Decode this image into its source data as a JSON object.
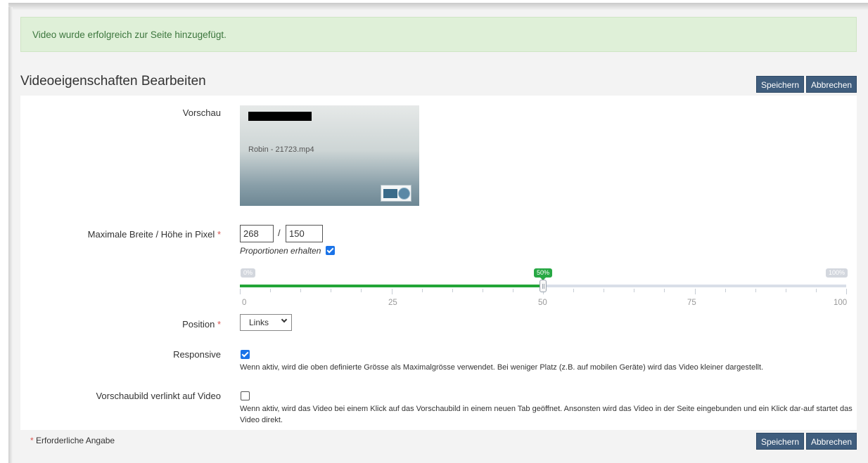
{
  "alert": {
    "message": "Video wurde erfolgreich zur Seite hinzugefügt."
  },
  "header": {
    "title": "Videoeigenschaften Bearbeiten",
    "save_label": "Speichern",
    "cancel_label": "Abbrechen"
  },
  "form": {
    "preview": {
      "label": "Vorschau",
      "slide_title": "Robin - 21723.mp4"
    },
    "size": {
      "label": "Maximale Breite / Höhe in Pixel",
      "required_marker": "*",
      "width_value": "268",
      "separator": "/",
      "height_value": "150",
      "keep_proportions_label": "Proportionen erhalten",
      "keep_proportions_checked": true
    },
    "slider": {
      "min_label": "0%",
      "max_label": "100%",
      "value_label": "50%",
      "value": 50,
      "scale": [
        "0",
        "25",
        "50",
        "75",
        "100"
      ]
    },
    "position": {
      "label": "Position",
      "required_marker": "*",
      "selected": "Links"
    },
    "responsive": {
      "label": "Responsive",
      "checked": true,
      "help": "Wenn aktiv, wird die oben definierte Grösse als Maximalgrösse verwendet. Bei weniger Platz (z.B. auf mobilen Geräte) wird das Video kleiner dargestellt."
    },
    "thumbnail_link": {
      "label": "Vorschaubild verlinkt auf Video",
      "checked": false,
      "help": "Wenn aktiv, wird das Video bei einem Klick auf das Vorschaubild in einem neuen Tab geöffnet. Ansonsten wird das Video in der Seite eingebunden und ein Klick dar-auf startet das Video direkt."
    }
  },
  "footer": {
    "required_marker": "*",
    "required_note": "Erforderliche Angabe",
    "save_label": "Speichern",
    "cancel_label": "Abbrechen"
  },
  "colors": {
    "primary_button": "#3f5d7d",
    "alert_bg": "#dff0d8",
    "slider_fill": "#22a537",
    "required": "#d9534f"
  }
}
